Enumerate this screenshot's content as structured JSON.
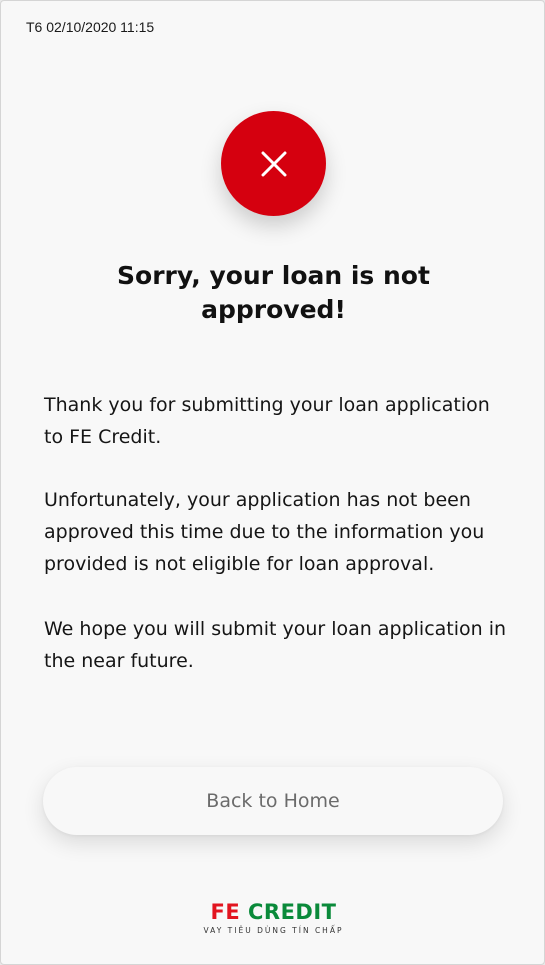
{
  "status_bar": {
    "datetime": "T6 02/10/2020 11:15"
  },
  "result": {
    "icon": "close-icon",
    "icon_bg_color": "#d5000f",
    "title": "Sorry, your loan is not approved!",
    "paragraphs": [
      "Thank you for submitting your loan application to FE Credit.",
      "Unfortunately, your application has not been approved this time due to the information you provided is not eligible for loan approval.",
      "We hope you will submit your loan application in the near future."
    ]
  },
  "actions": {
    "back_home_label": "Back to Home"
  },
  "brand": {
    "name_part1": "FE",
    "name_part2": "CREDIT",
    "tagline": "VAY TIÊU DÙNG TÍN CHẤP",
    "color_fe": "#e2141f",
    "color_credit": "#0a8a3a"
  }
}
